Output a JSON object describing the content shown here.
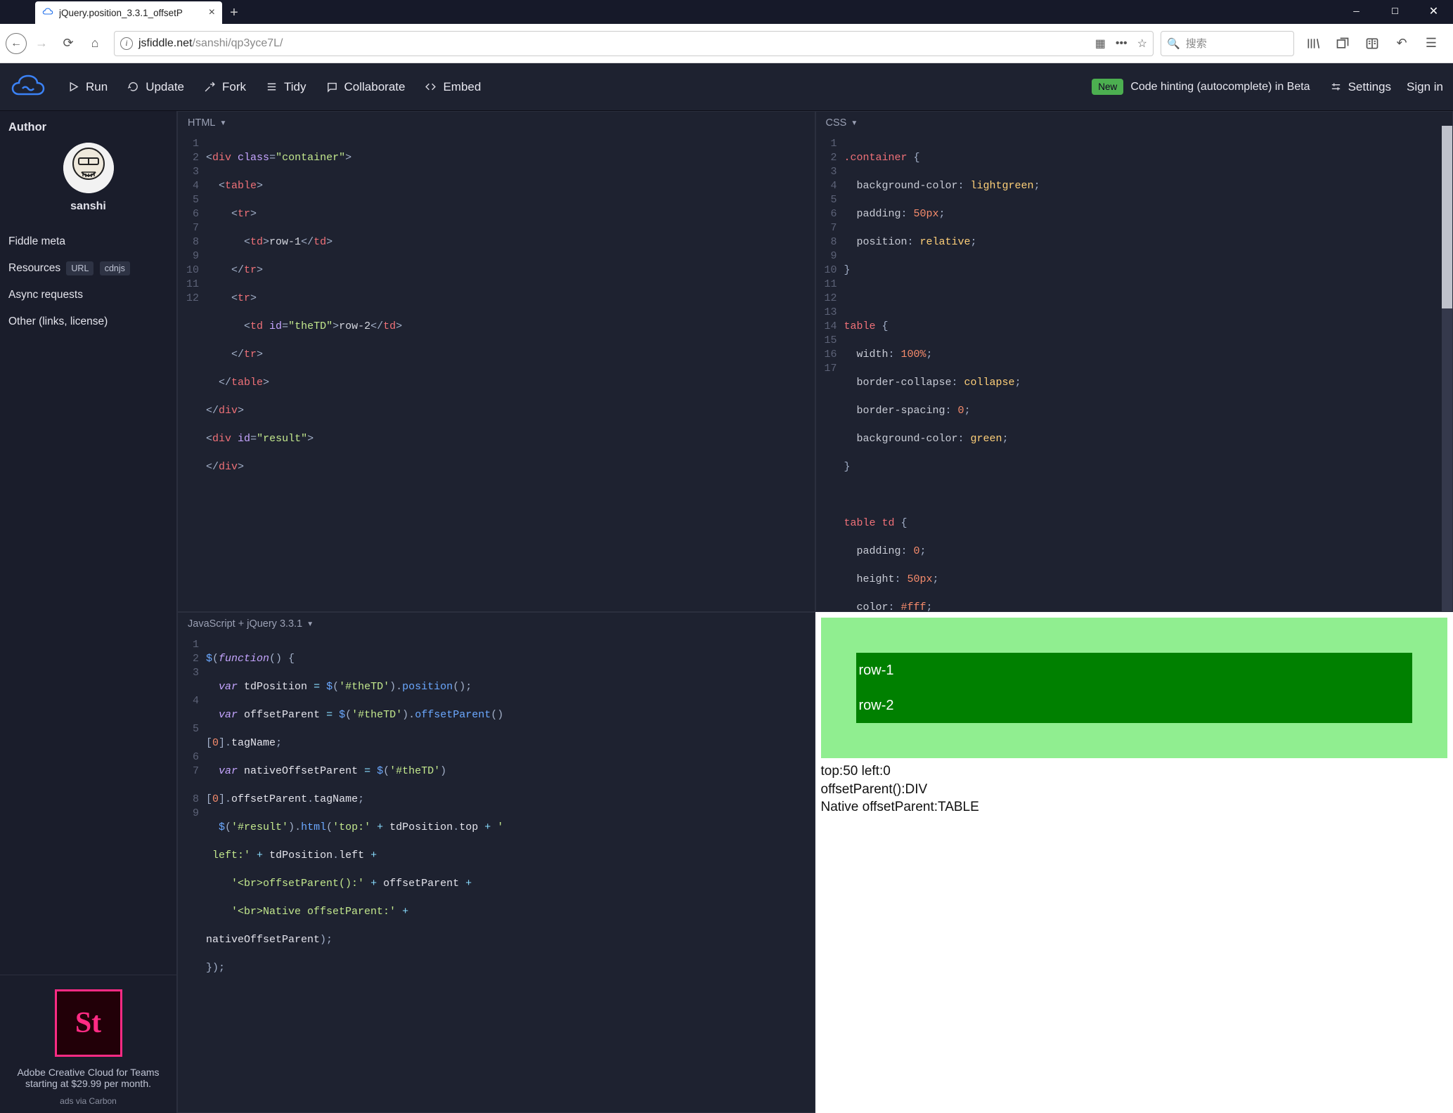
{
  "browser": {
    "tab_title": "jQuery.position_3.3.1_offsetP",
    "url_host": "jsfiddle.net",
    "url_path": "/sanshi/qp3yce7L/",
    "search_placeholder": "搜索"
  },
  "toolbar": {
    "run": "Run",
    "update": "Update",
    "fork": "Fork",
    "tidy": "Tidy",
    "collaborate": "Collaborate",
    "embed": "Embed",
    "new_badge": "New",
    "hint": "Code hinting (autocomplete) in Beta",
    "settings": "Settings",
    "signin": "Sign in"
  },
  "sidebar": {
    "author_heading": "Author",
    "username": "sanshi",
    "fiddle_meta": "Fiddle meta",
    "resources": "Resources",
    "url_badge": "URL",
    "cdnjs_badge": "cdnjs",
    "async": "Async requests",
    "other": "Other (links, license)",
    "ad_logo": "St",
    "ad_line1": "Adobe Creative Cloud for Teams",
    "ad_line2": "starting at $29.99 per month.",
    "ad_caption": "ads via Carbon"
  },
  "panels": {
    "html_label": "HTML",
    "css_label": "CSS",
    "js_label": "JavaScript + jQuery 3.3.1"
  },
  "html_code": {
    "lines": 12,
    "l1": {
      "a": "<",
      "b": "div",
      "c": " ",
      "d": "class",
      "e": "=",
      "f": "\"container\"",
      "g": ">"
    },
    "l2": {
      "a": "  <",
      "b": "table",
      "c": ">"
    },
    "l3": {
      "a": "    <",
      "b": "tr",
      "c": ">"
    },
    "l4": {
      "a": "      <",
      "b": "td",
      "c": ">",
      "t": "row-1",
      "d": "</",
      "e": "td",
      "f": ">"
    },
    "l5": {
      "a": "    </",
      "b": "tr",
      "c": ">"
    },
    "l6": {
      "a": "    <",
      "b": "tr",
      "c": ">"
    },
    "l7": {
      "a": "      <",
      "b": "td",
      "c": " ",
      "d": "id",
      "e": "=",
      "f": "\"theTD\"",
      "g": ">",
      "t": "row-2",
      "h": "</",
      "i": "td",
      "j": ">"
    },
    "l8": {
      "a": "    </",
      "b": "tr",
      "c": ">"
    },
    "l9": {
      "a": "  </",
      "b": "table",
      "c": ">"
    },
    "l10": {
      "a": "</",
      "b": "div",
      "c": ">"
    },
    "l11": {
      "a": "<",
      "b": "div",
      "c": " ",
      "d": "id",
      "e": "=",
      "f": "\"result\"",
      "g": ">"
    },
    "l12": {
      "a": "</",
      "b": "div",
      "c": ">"
    }
  },
  "css_code": {
    "l1": {
      "sel": ".container",
      "b": " {"
    },
    "l2": {
      "p": "  background-color",
      "c": ": ",
      "v": "lightgreen",
      "s": ";"
    },
    "l3": {
      "p": "  padding",
      "c": ": ",
      "v": "50px",
      "s": ";"
    },
    "l4": {
      "p": "  position",
      "c": ": ",
      "v": "relative",
      "s": ";"
    },
    "l5": {
      "b": "}"
    },
    "l6": {
      "b": ""
    },
    "l7": {
      "sel": "table",
      "b": " {"
    },
    "l8": {
      "p": "  width",
      "c": ": ",
      "v": "100%",
      "s": ";"
    },
    "l9": {
      "p": "  border-collapse",
      "c": ": ",
      "v": "collapse",
      "s": ";"
    },
    "l10": {
      "p": "  border-spacing",
      "c": ": ",
      "v": "0",
      "s": ";"
    },
    "l11": {
      "p": "  background-color",
      "c": ": ",
      "v": "green",
      "s": ";"
    },
    "l12": {
      "b": "}"
    },
    "l13": {
      "b": ""
    },
    "l14": {
      "sel": "table td",
      "b": " {"
    },
    "l15": {
      "p": "  padding",
      "c": ": ",
      "v": "0",
      "s": ";"
    },
    "l16": {
      "p": "  height",
      "c": ": ",
      "v": "50px",
      "s": ";"
    },
    "l17": {
      "p": "  color",
      "c": ": ",
      "v": "#fff",
      "s": ";"
    }
  },
  "js_code": {
    "l1": "$(function() {",
    "l2": "  var tdPosition = $('#theTD').position();",
    "l3a": "  var offsetParent = $('#theTD').offsetParent()",
    "l3b": "[0].tagName;",
    "l4a": "  var nativeOffsetParent = $('#theTD')",
    "l4b": "[0].offsetParent.tagName;",
    "l5a": "  $('#result').html('top:' + tdPosition.top + '",
    "l5b": " left:' + tdPosition.left +",
    "l6": "    '<br>offsetParent():' + offsetParent +",
    "l7a": "    '<br>Native offsetParent:' + ",
    "l7b": "nativeOffsetParent);",
    "l8": "});",
    "l9": ""
  },
  "result": {
    "row1": "row-1",
    "row2": "row-2",
    "line1": "top:50 left:0",
    "line2": "offsetParent():DIV",
    "line3": "Native offsetParent:TABLE"
  }
}
